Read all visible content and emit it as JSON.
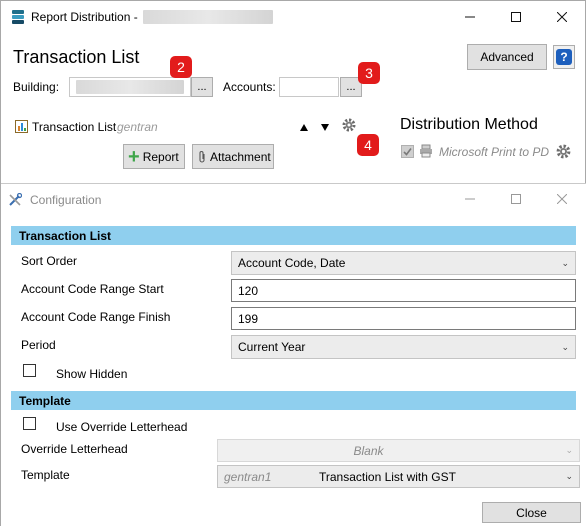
{
  "outer": {
    "title": "Report Distribution -",
    "heading": "Transaction List",
    "advanced_label": "Advanced",
    "help_label": "?",
    "building_label": "Building:",
    "accounts_label": "Accounts:",
    "browse_label": "...",
    "report_name": "Transaction List",
    "report_sub": "gentran",
    "report_btn": "Report",
    "attachment_btn": "Attachment",
    "distribution_heading": "Distribution Method",
    "print_method": "Microsoft Print to PD",
    "badges": [
      "2",
      "3",
      "4"
    ]
  },
  "config": {
    "title": "Configuration",
    "section1": "Transaction List",
    "sort_order_label": "Sort Order",
    "sort_order_value": "Account Code, Date",
    "range_start_label": "Account Code Range Start",
    "range_start_value": "120",
    "range_finish_label": "Account Code Range Finish",
    "range_finish_value": "199",
    "period_label": "Period",
    "period_value": "Current Year",
    "show_hidden_label": "Show Hidden",
    "section2": "Template",
    "override_check_label": "Use Override Letterhead",
    "override_letterhead_label": "Override Letterhead",
    "override_letterhead_value": "Blank",
    "template_label": "Template",
    "template_code": "gentran1",
    "template_value": "Transaction List with GST",
    "close_label": "Close"
  },
  "icons": {
    "app": "app-logo-icon",
    "minimize": "minimize-icon",
    "maximize": "maximize-icon",
    "close": "close-icon"
  },
  "colors": {
    "section_bg": "#8fcfee",
    "badge": "#e21b1b",
    "report_plus": "#3fa54a"
  }
}
